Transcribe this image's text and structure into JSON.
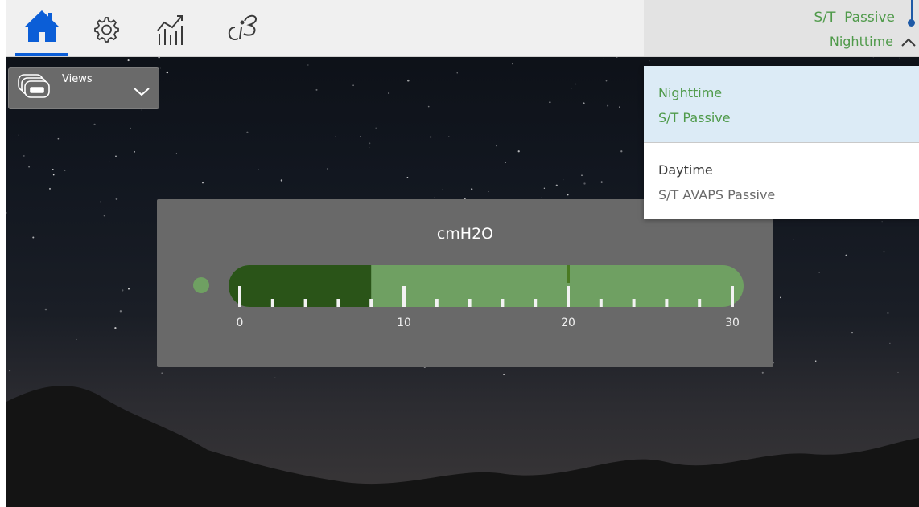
{
  "top_bar": {
    "nav": [
      {
        "name": "home",
        "icon": "home-icon"
      },
      {
        "name": "settings",
        "icon": "gear-icon"
      },
      {
        "name": "trends",
        "icon": "trend-chart-icon"
      },
      {
        "name": "tools",
        "icon": "tools-icon"
      }
    ],
    "mode_primary": "S/T  Passive",
    "mode_secondary": "Nighttime",
    "active_tab": "home"
  },
  "views": {
    "label": "Views",
    "icon": "views-stack-icon"
  },
  "gauge": {
    "unit": "cmH2O",
    "value": 8,
    "target": 20,
    "min": 0,
    "max": 30,
    "major_ticks": [
      "0",
      "10",
      "20",
      "30"
    ]
  },
  "mode_menu": {
    "items": [
      {
        "title": "Nighttime",
        "subtitle": "S/T  Passive",
        "selected": true
      },
      {
        "title": "Daytime",
        "subtitle": "S/T AVAPS Passive",
        "selected": false
      }
    ]
  },
  "colors": {
    "accent_green": "#4f9a4a",
    "active_blue": "#0b5ed7",
    "gauge_fill": "#2a5418",
    "gauge_track": "#6fa062",
    "selected_row": "#dcebf6"
  }
}
